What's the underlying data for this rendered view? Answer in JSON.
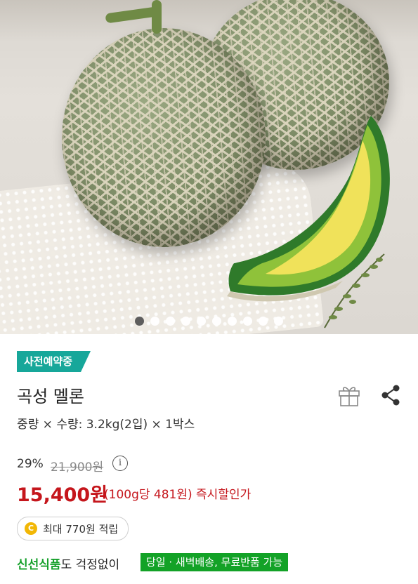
{
  "hero": {
    "image_icon": "cantaloupe-melon-photo",
    "slide_count": 10,
    "active_slide": 1
  },
  "product": {
    "badge": "사전예약중",
    "title": "곡성 멜론",
    "spec": "중량 × 수량: 3.2kg(2입) × 1박스",
    "discount_pct": "29%",
    "original_price": "21,900원",
    "info_symbol": "i",
    "price": "15,400원",
    "price_note": "(100g당 481원) 즉시할인가"
  },
  "points": {
    "coin_symbol": "C",
    "label": "최대 770원 적립"
  },
  "promo": {
    "highlight": "신선식품",
    "text": "도 걱정없이",
    "delivery_tag": "당일 · 새벽배송, 무료반품 가능"
  },
  "icons": {
    "gift": "gift-icon",
    "share": "share-icon"
  },
  "colors": {
    "badge": "#17a79a",
    "price": "#c5161c",
    "delivery_tag": "#13a227",
    "highlight": "#17a12c"
  }
}
